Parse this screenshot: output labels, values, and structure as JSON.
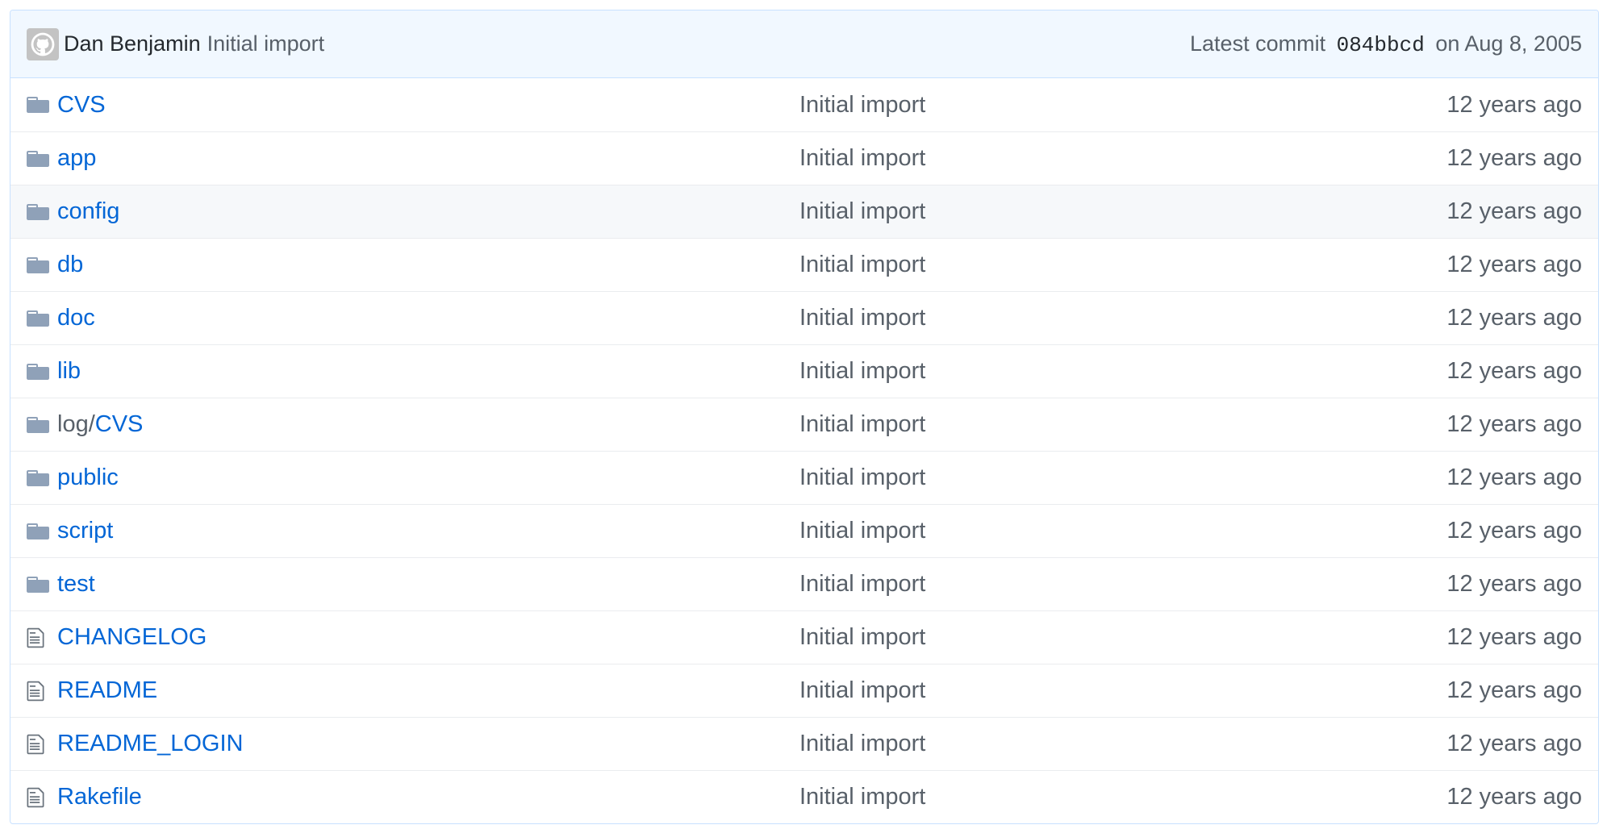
{
  "commit": {
    "author": "Dan Benjamin",
    "message": "Initial import",
    "latest_label": "Latest commit",
    "sha": "084bbcd",
    "date_text": "on Aug 8, 2005"
  },
  "colors": {
    "link": "#0366d6",
    "muted": "#586069",
    "folder": "#79b8ff"
  },
  "rows": [
    {
      "type": "folder",
      "prefix": "",
      "name": "CVS",
      "message": "Initial import",
      "age": "12 years ago"
    },
    {
      "type": "folder",
      "prefix": "",
      "name": "app",
      "message": "Initial import",
      "age": "12 years ago"
    },
    {
      "type": "folder",
      "prefix": "",
      "name": "config",
      "message": "Initial import",
      "age": "12 years ago"
    },
    {
      "type": "folder",
      "prefix": "",
      "name": "db",
      "message": "Initial import",
      "age": "12 years ago"
    },
    {
      "type": "folder",
      "prefix": "",
      "name": "doc",
      "message": "Initial import",
      "age": "12 years ago"
    },
    {
      "type": "folder",
      "prefix": "",
      "name": "lib",
      "message": "Initial import",
      "age": "12 years ago"
    },
    {
      "type": "folder",
      "prefix": "log/",
      "name": "CVS",
      "message": "Initial import",
      "age": "12 years ago"
    },
    {
      "type": "folder",
      "prefix": "",
      "name": "public",
      "message": "Initial import",
      "age": "12 years ago"
    },
    {
      "type": "folder",
      "prefix": "",
      "name": "script",
      "message": "Initial import",
      "age": "12 years ago"
    },
    {
      "type": "folder",
      "prefix": "",
      "name": "test",
      "message": "Initial import",
      "age": "12 years ago"
    },
    {
      "type": "file",
      "prefix": "",
      "name": "CHANGELOG",
      "message": "Initial import",
      "age": "12 years ago"
    },
    {
      "type": "file",
      "prefix": "",
      "name": "README",
      "message": "Initial import",
      "age": "12 years ago"
    },
    {
      "type": "file",
      "prefix": "",
      "name": "README_LOGIN",
      "message": "Initial import",
      "age": "12 years ago"
    },
    {
      "type": "file",
      "prefix": "",
      "name": "Rakefile",
      "message": "Initial import",
      "age": "12 years ago"
    }
  ],
  "hovered_row": 2
}
